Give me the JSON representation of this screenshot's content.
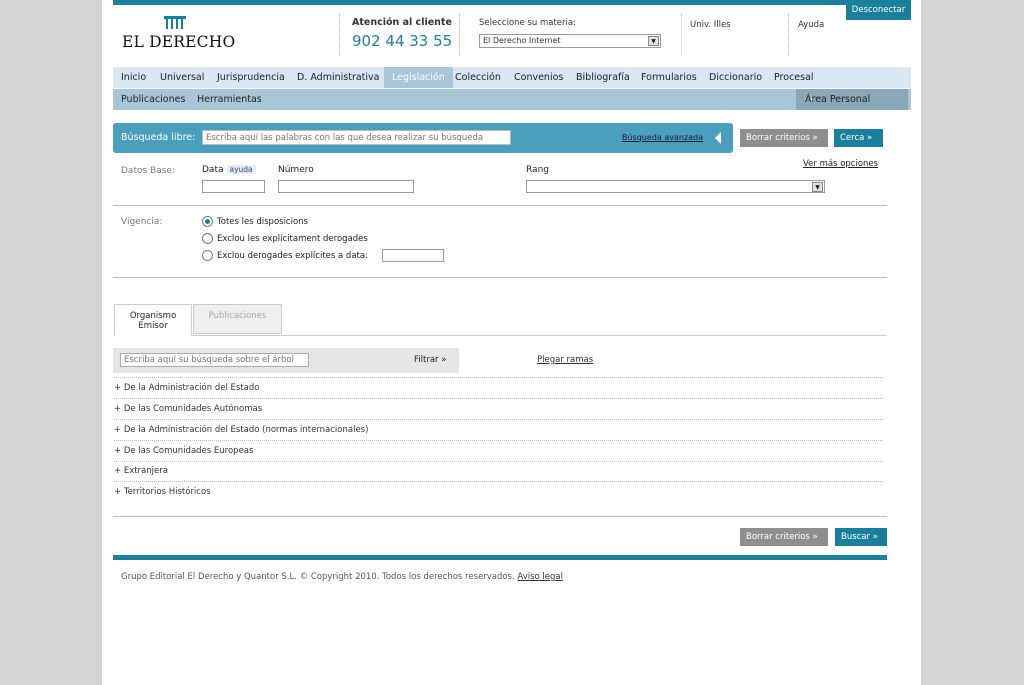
{
  "header": {
    "disconnect_label": "Desconectar",
    "logo_text": "EL DERECHO",
    "contact_label": "Atención al cliente",
    "contact_phone": "902 44 33 55",
    "materia_label": "Seleccione su materia:",
    "materia_selected": "El Derecho Internet",
    "user_label": "Univ. Illes",
    "help_label": "Ayuda"
  },
  "nav": {
    "primary": [
      "Inicio",
      "Universal",
      "Jurisprudencia",
      "D. Administrativa",
      "Legislación",
      "Colección",
      "Convenios",
      "Bibliografía",
      "Formularios",
      "Diccionario",
      "Procesal"
    ],
    "active": "Legislación",
    "secondary": [
      "Publicaciones",
      "Herramientas"
    ],
    "area_personal": "Área Personal"
  },
  "search": {
    "label": "Búsqueda libre:",
    "placeholder": "Escriba aquí las palabras con las que desea realizar su búsqueda",
    "advanced_link": "Búsqueda avanzada",
    "clear_label": "Borrar criterios »",
    "search_label": "Cerca »"
  },
  "datos": {
    "label": "Datos Base:",
    "data_label": "Data",
    "ayuda_tag": "ayuda",
    "numero_label": "Número",
    "rang_label": "Rang",
    "more_options": "Ver más opciones"
  },
  "vigencia": {
    "label": "Vigencia:",
    "options": [
      "Totes les disposicions",
      "Exclou les explícitament derogades",
      "Exclou derogades explícites a data:"
    ],
    "selected_index": 0
  },
  "tabs": {
    "active": "Organismo Emisor",
    "inactive": "Publicaciones"
  },
  "tree": {
    "filter_placeholder": "Escriba aquí su búsqueda sobre el árbol",
    "filter_label": "Filtrar »",
    "collapse_link": "Plegar ramas",
    "items": [
      "+ De la Administración del Estado",
      "+ De las Comunidades Autónomas",
      "+ De la Administración del Estado (normas internacionales)",
      "+ De las Comunidades Europeas",
      "+ Extranjera",
      "+ Territorios Históricos"
    ]
  },
  "bottom_actions": {
    "clear_label": "Borrar criterios »",
    "search_label": "Buscar »"
  },
  "footer": {
    "text": "Grupo Editorial El Derecho y Quantor S.L. © Copyright 2010. Todos los derechos reservados.",
    "legal_link": "Aviso legal"
  },
  "colors": {
    "brand": "#1a7f9c",
    "nav_bg": "#d8e7f1",
    "nav2_bg": "#a9c6d8",
    "search_bar": "#4a9fbe"
  }
}
